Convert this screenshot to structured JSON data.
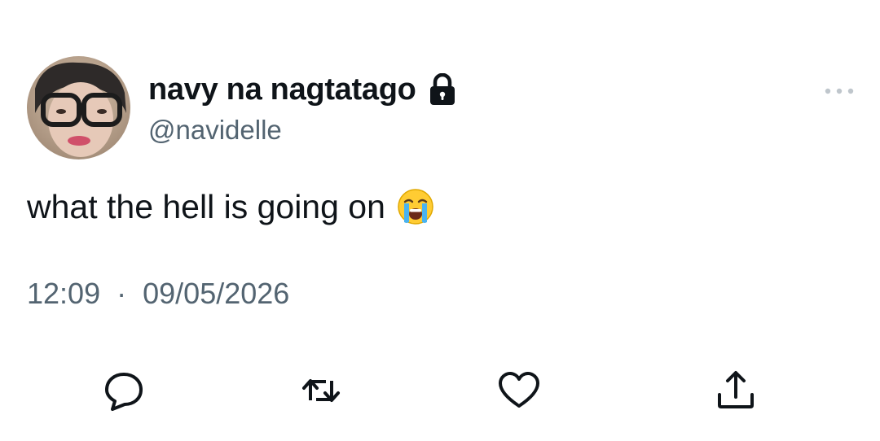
{
  "tweet": {
    "author": {
      "display_name": "navy na nagtatago",
      "handle": "@navidelle",
      "protected_icon": "lock-icon",
      "avatar_icon": "avatar"
    },
    "text": "what the hell is going on",
    "emoji": "loudly-crying-face",
    "time": "12:09",
    "separator": "·",
    "date": "09/05/2026",
    "more_icon": "ellipsis-icon"
  },
  "actions": [
    {
      "icon": "reply-icon"
    },
    {
      "icon": "retweet-icon"
    },
    {
      "icon": "like-icon"
    },
    {
      "icon": "share-icon"
    }
  ],
  "colors": {
    "text_primary": "#0f1419",
    "text_secondary": "#536471",
    "background": "#ffffff"
  }
}
